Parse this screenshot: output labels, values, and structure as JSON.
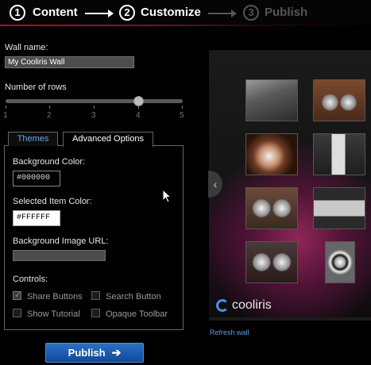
{
  "wizard": {
    "steps": [
      {
        "number": "1",
        "label": "Content"
      },
      {
        "number": "2",
        "label": "Customize"
      },
      {
        "number": "3",
        "label": "Publish"
      }
    ]
  },
  "form": {
    "wall_name_label": "Wall name:",
    "wall_name_value": "My Cooliris Wall",
    "rows_label": "Number of rows",
    "rows_ticks": [
      "1",
      "2",
      "3",
      "4",
      "5"
    ],
    "rows_value": 4
  },
  "tabs": {
    "themes": "Themes",
    "advanced": "Advanced Options",
    "active": "Advanced Options"
  },
  "advanced": {
    "bg_color_label": "Background Color:",
    "bg_color_value": "#000000",
    "selected_color_label": "Selected Item Color:",
    "selected_color_value": "#FFFFFF",
    "bg_image_label": "Background Image URL:",
    "bg_image_value": "",
    "controls_label": "Controls:",
    "controls": [
      {
        "label": "Share Buttons",
        "checked": true
      },
      {
        "label": "Search Button",
        "checked": false
      },
      {
        "label": "Show Tutorial",
        "checked": false
      },
      {
        "label": "Opaque Toolbar",
        "checked": false
      }
    ]
  },
  "publish_button": {
    "label": "Publish",
    "arrow_icon": "arrow-right-icon"
  },
  "preview": {
    "logo_text": "cooliris",
    "refresh_link": "Refresh wall",
    "nav_icon": "chevron-left-icon"
  },
  "colors": {
    "accent_blue": "#2a6fc4",
    "link_blue": "#5c9be0",
    "header_rule_red": "#b0102a"
  }
}
